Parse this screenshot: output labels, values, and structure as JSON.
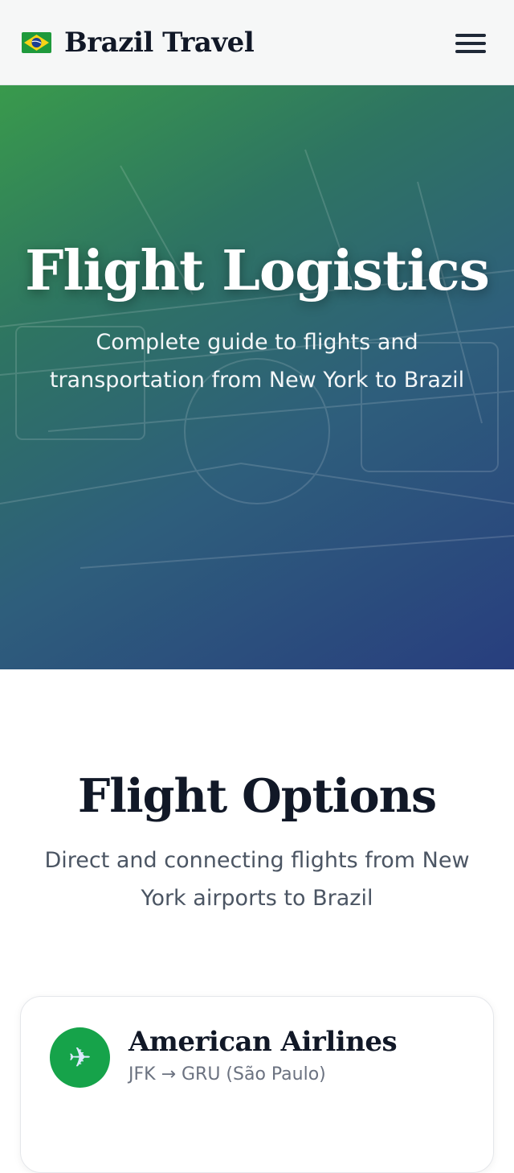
{
  "header": {
    "brand_title": "Brazil Travel",
    "flag_icon": "brazil-flag-icon",
    "menu_icon": "hamburger-menu-icon"
  },
  "hero": {
    "title": "Flight Logistics",
    "subtitle": "Complete guide to flights and transportation from New York to Brazil",
    "gradient_colors": [
      "#399a4c",
      "#2e5e7c",
      "#283e7e"
    ]
  },
  "section": {
    "title": "Flight Options",
    "subtitle": "Direct and connecting flights from New York airports to Brazil"
  },
  "flights": [
    {
      "airline": "American Airlines",
      "route": "JFK → GRU (São Paulo)",
      "icon": "airplane-icon",
      "icon_bg": "#16a34a"
    }
  ],
  "colors": {
    "header_bg": "#f6f7f7",
    "text_dark": "#111827",
    "text_muted": "#4b5563",
    "accent_green": "#16a34a"
  }
}
